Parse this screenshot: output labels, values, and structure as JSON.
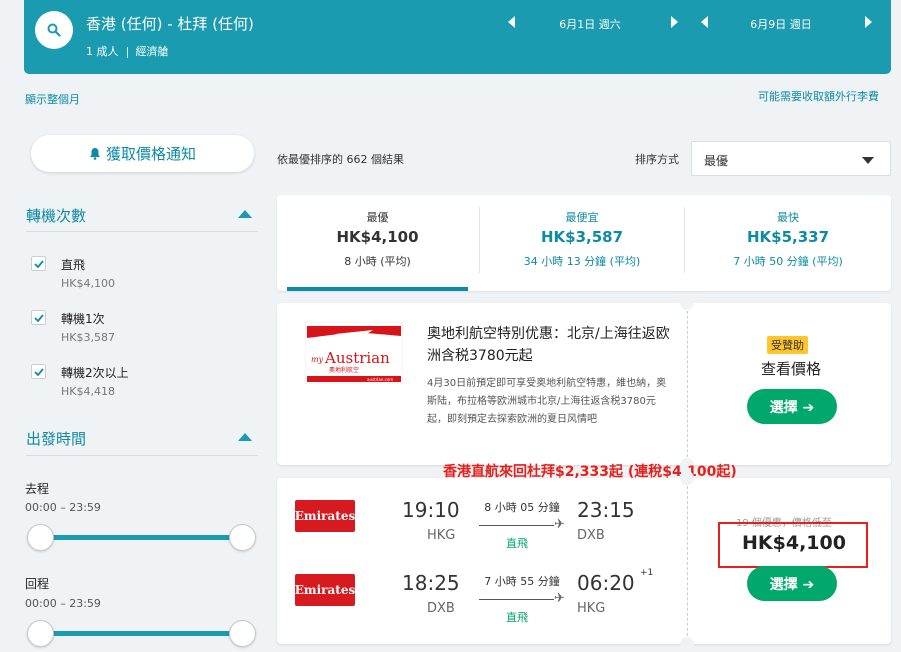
{
  "header": {
    "route": "香港 (任何) - 杜拜 (任何)",
    "passengers": "1 成人",
    "cabin": "經濟艙",
    "depart_date": "6月1日 週六",
    "return_date": "6月9日 週日"
  },
  "links": {
    "show_month": "顯示整個月",
    "baggage_fees": "可能需要收取額外行李費"
  },
  "sidebar": {
    "price_alert": "獲取價格通知",
    "stops_title": "轉機次數",
    "stops": [
      {
        "label": "直飛",
        "price": "HK$4,100",
        "checked": true
      },
      {
        "label": "轉機1次",
        "price": "HK$3,587",
        "checked": true
      },
      {
        "label": "轉機2次以上",
        "price": "HK$4,418",
        "checked": true
      }
    ],
    "times_title": "出發時間",
    "outbound_label": "去程",
    "outbound_range": "00:00 – 23:59",
    "return_label": "回程",
    "return_range": "00:00 – 23:59"
  },
  "results": {
    "count_text": "依最優排序的 662 個結果",
    "sort_label": "排序方式",
    "sort_value": "最優"
  },
  "tabs": [
    {
      "label": "最優",
      "price": "HK$4,100",
      "duration": "8 小時 (平均)",
      "active": true
    },
    {
      "label": "最便宜",
      "price": "HK$3,587",
      "duration": "34 小時 13 分鐘 (平均)",
      "active": false
    },
    {
      "label": "最快",
      "price": "HK$5,337",
      "duration": "7 小時 50 分鐘 (平均)",
      "active": false
    }
  ],
  "ad": {
    "logo_brand": "myAustrian",
    "logo_sub": "奧地利航空",
    "logo_url": "austrian.com",
    "title": "奧地利航空特別优惠：北京/上海往返欧洲含税3780元起",
    "description": "4月30日前預定即可享受奥地利航空特惠，維也納，奥斯陆，布拉格等欧洲城市北京/上海往返含税3780元起，即刻預定去探索欧洲的夏日风情吧",
    "sponsored": "受贊助",
    "view_price": "查看價格",
    "select": "選擇 ➔"
  },
  "promo_text": "香港直航來回杜拜$2,333起 (連稅$4,100起)",
  "flight": {
    "airline": "Emirates",
    "legs": [
      {
        "dep_time": "19:10",
        "dep_code": "HKG",
        "duration": "8 小時 05 分鐘",
        "stops": "直飛",
        "arr_time": "23:15",
        "arr_code": "DXB",
        "day_offset": ""
      },
      {
        "dep_time": "18:25",
        "dep_code": "DXB",
        "duration": "7 小時 55 分鐘",
        "stops": "直飛",
        "arr_time": "06:20",
        "arr_code": "HKG",
        "day_offset": "+1"
      }
    ],
    "deals_text": "19 個優惠，價格低至",
    "price": "HK$4,100",
    "select": "選擇 ➔"
  },
  "colors": {
    "brand": "#1a9bb0",
    "link": "#0e8ba4",
    "select_green": "#00a86b",
    "highlight_red": "#e8201a",
    "emirates_red": "#d71920"
  }
}
